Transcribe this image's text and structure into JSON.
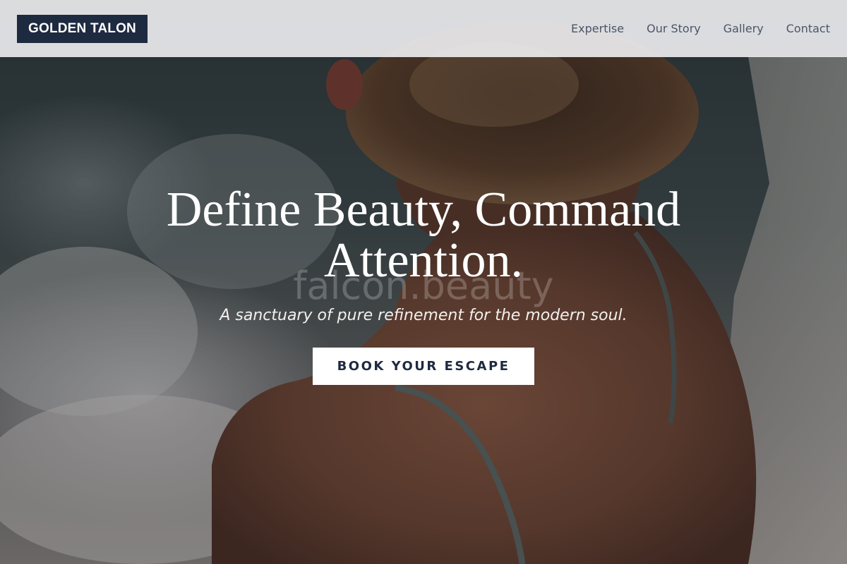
{
  "brand": {
    "name": "GOLDEN TALON"
  },
  "nav": {
    "items": [
      {
        "label": "Expertise"
      },
      {
        "label": "Our Story"
      },
      {
        "label": "Gallery"
      },
      {
        "label": "Contact"
      }
    ]
  },
  "hero": {
    "headline": "Define Beauty, Command Attention.",
    "watermark": "falcon.beauty",
    "subtitle": "A sanctuary of pure refinement for the modern soul.",
    "cta_label": "BOOK YOUR ESCAPE",
    "image": "woman-in-bath-back-view"
  },
  "colors": {
    "brand_navy": "#1e2a40",
    "nav_text": "#4b5566",
    "nav_bg": "#f0f0f2",
    "headline": "#ffffff",
    "cta_bg": "#ffffff"
  }
}
